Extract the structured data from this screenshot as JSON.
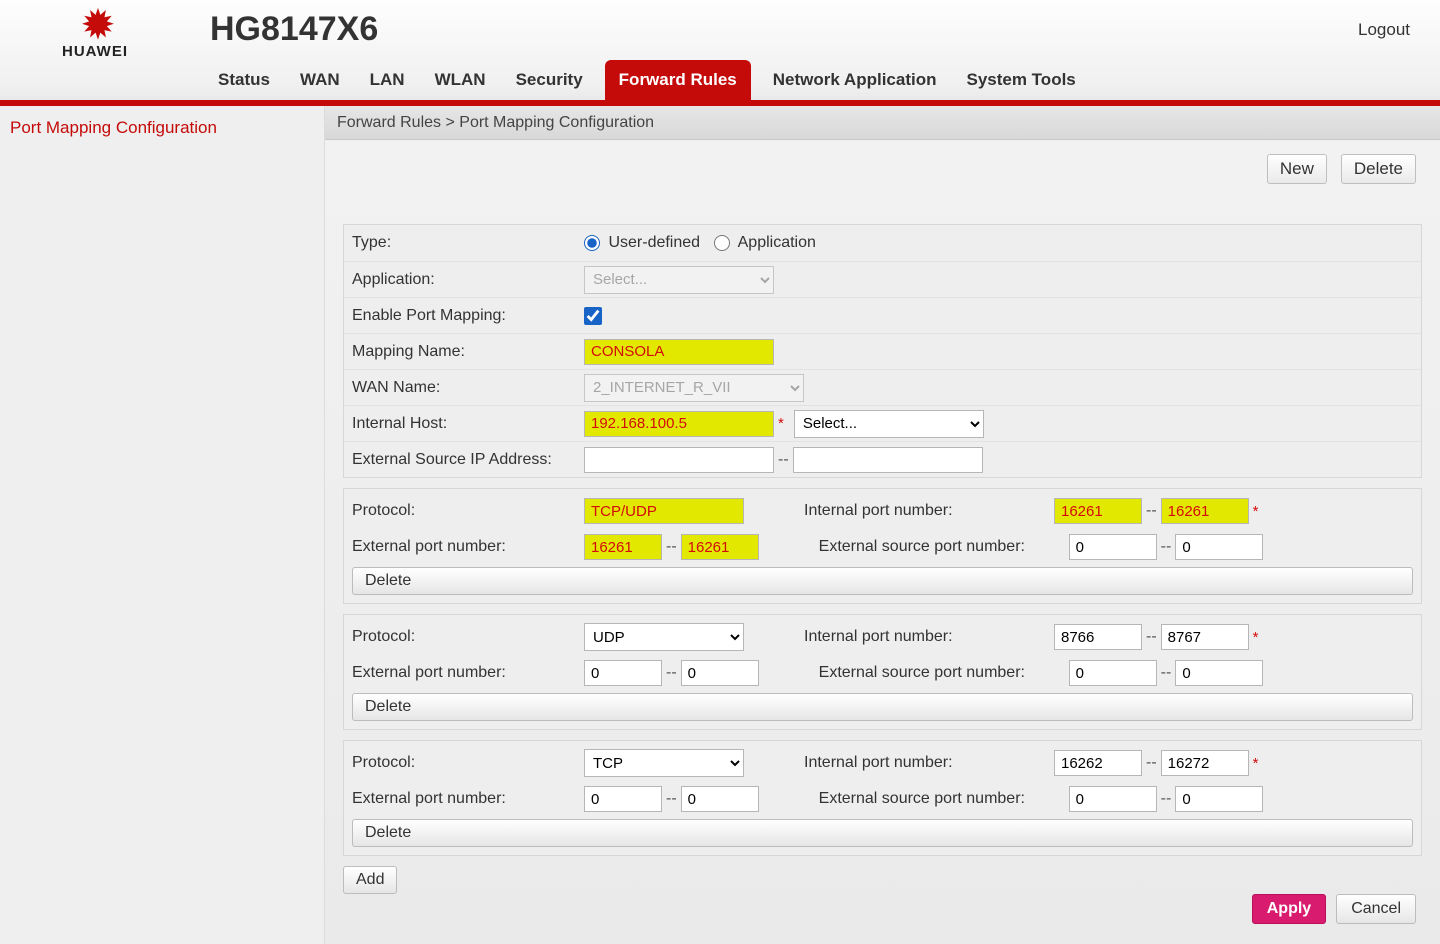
{
  "brand": "HUAWEI",
  "model": "HG8147X6",
  "logout_label": "Logout",
  "nav": [
    "Status",
    "WAN",
    "LAN",
    "WLAN",
    "Security",
    "Forward Rules",
    "Network Application",
    "System Tools"
  ],
  "active_nav_index": 5,
  "sidebar": {
    "items": [
      {
        "label": "Port Mapping Configuration"
      }
    ]
  },
  "breadcrumb": "Forward Rules > Port Mapping Configuration",
  "toolbar": {
    "new_label": "New",
    "delete_label": "Delete"
  },
  "form": {
    "labels": {
      "type": "Type:",
      "type_user": "User-defined",
      "type_app": "Application",
      "application": "Application:",
      "app_placeholder": "Select...",
      "enable": "Enable Port Mapping:",
      "mapping_name": "Mapping Name:",
      "wan_name": "WAN Name:",
      "wan_value": "2_INTERNET_R_VII",
      "internal_host": "Internal Host:",
      "host_select_placeholder": "Select...",
      "ext_src_ip": "External Source IP Address:"
    },
    "values": {
      "type": "user",
      "enable": true,
      "mapping_name": "CONSOLA",
      "internal_host": "192.168.100.5",
      "ext_src_ip_a": "",
      "ext_src_ip_b": ""
    }
  },
  "port_labels": {
    "protocol": "Protocol:",
    "internal_port": "Internal port number:",
    "external_port": "External port number:",
    "external_src_port": "External source port number:",
    "delete": "Delete"
  },
  "ports": [
    {
      "protocol": "TCP/UDP",
      "protocol_hl": true,
      "int_a": "16261",
      "int_b": "16261",
      "int_hl": true,
      "ext_a": "16261",
      "ext_b": "16261",
      "ext_hl": true,
      "src_a": "0",
      "src_b": "0"
    },
    {
      "protocol": "UDP",
      "protocol_hl": false,
      "int_a": "8766",
      "int_b": "8767",
      "int_hl": false,
      "ext_a": "0",
      "ext_b": "0",
      "ext_hl": false,
      "src_a": "0",
      "src_b": "0"
    },
    {
      "protocol": "TCP",
      "protocol_hl": false,
      "int_a": "16262",
      "int_b": "16272",
      "int_hl": false,
      "ext_a": "0",
      "ext_b": "0",
      "ext_hl": false,
      "src_a": "0",
      "src_b": "0"
    }
  ],
  "add_label": "Add",
  "footer": {
    "apply": "Apply",
    "cancel": "Cancel"
  }
}
